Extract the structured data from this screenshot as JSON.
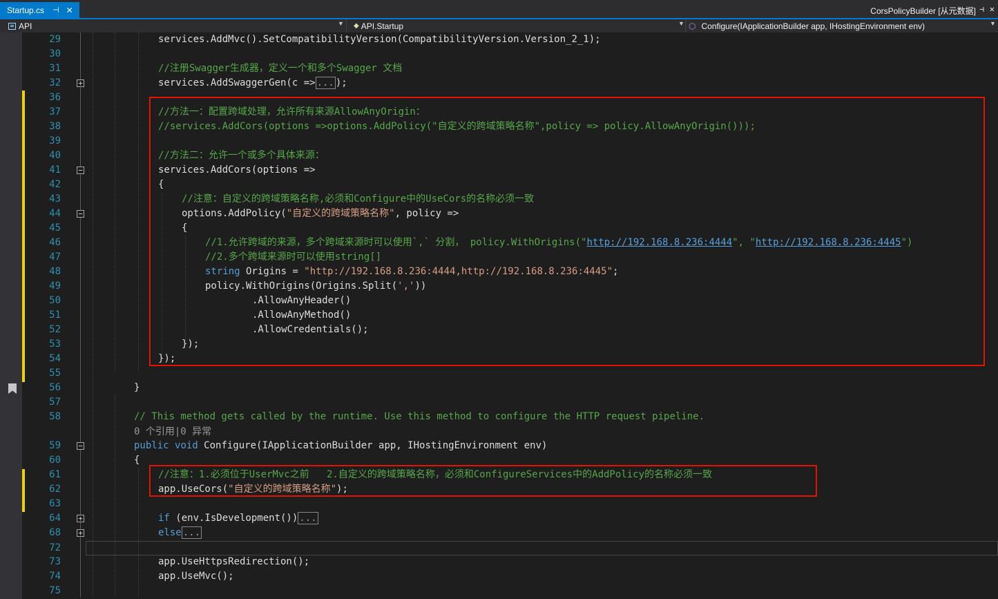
{
  "tabs": {
    "active_file": "Startup.cs",
    "pin_glyph": "⊣",
    "close_glyph": "✕",
    "right_title": "CorsPolicyBuilder [从元数据]",
    "right_pin_glyph": "⊣",
    "right_close_glyph": "✕"
  },
  "navbar": {
    "project": "API",
    "class_name": "API.Startup",
    "member": "Configure(IApplicationBuilder app, IHostingEnvironment env)"
  },
  "colors": {
    "accent": "#007acc",
    "highlight_box": "#e51400",
    "change_marker": "#f2d100",
    "keyword": "#569cd6",
    "string": "#d69d85",
    "comment": "#57a64a",
    "line_number": "#2b91af"
  },
  "editor": {
    "line_numbers": [
      "29",
      "30",
      "31",
      "32",
      "36",
      "37",
      "38",
      "39",
      "40",
      "41",
      "42",
      "43",
      "44",
      "45",
      "46",
      "47",
      "48",
      "49",
      "50",
      "51",
      "52",
      "53",
      "54",
      "55",
      "56",
      "57",
      "58",
      "59",
      "60",
      "61",
      "62",
      "63",
      "64",
      "68",
      "72",
      "73",
      "74",
      "75"
    ],
    "code_lens": "0 个引用|0 异常",
    "lines": [
      [
        {
          "t": "services.AddMvc().SetCompatibilityVersion(CompatibilityVersion.Version_2_1);"
        }
      ],
      [],
      [
        {
          "t": "//注册Swagger生成器，定义一个和多个Swagger 文档",
          "c": "cmt"
        }
      ],
      [
        {
          "t": "services.AddSwaggerGen(c =>"
        },
        {
          "t": "...",
          "c": "collapsed"
        },
        {
          "t": ");"
        }
      ],
      [],
      [
        {
          "t": "//方法一：配置跨域处理，允许所有来源AllowAnyOrigin：",
          "c": "cmt"
        }
      ],
      [
        {
          "t": "//services.AddCors(options =>options.AddPolicy(\"自定义的跨域策略名称\",policy => policy.AllowAnyOrigin()));",
          "c": "cmt"
        }
      ],
      [],
      [
        {
          "t": "//方法二：允许一个或多个具体来源：",
          "c": "cmt"
        }
      ],
      [
        {
          "t": "services.AddCors(options =>"
        }
      ],
      [
        {
          "t": "{"
        }
      ],
      [
        {
          "t": "//注意：自定义的跨域策略名称,必须和Configure中的UseCors的名称必须一致",
          "c": "cmt"
        }
      ],
      [
        {
          "t": "options.AddPolicy("
        },
        {
          "t": "\"自定义的跨域策略名称\"",
          "c": "str"
        },
        {
          "t": ", policy =>"
        }
      ],
      [
        {
          "t": "{"
        }
      ],
      [
        {
          "t": "//1.允许跨域的来源，多个跨域来源时可以使用`,` 分割， policy.WithOrigins(\"",
          "c": "cmt"
        },
        {
          "t": "http://192.168.8.236:4444",
          "c": "link"
        },
        {
          "t": "\", \"",
          "c": "cmt"
        },
        {
          "t": "http://192.168.8.236:4445",
          "c": "link"
        },
        {
          "t": "\")",
          "c": "cmt"
        }
      ],
      [
        {
          "t": "//2.多个跨域来源时可以使用string[]",
          "c": "cmt"
        }
      ],
      [
        {
          "t": "string",
          "c": "kw"
        },
        {
          "t": " Origins = "
        },
        {
          "t": "\"http://192.168.8.236:4444,http://192.168.8.236:4445\"",
          "c": "str"
        },
        {
          "t": ";"
        }
      ],
      [
        {
          "t": "policy.WithOrigins(Origins.Split("
        },
        {
          "t": "','",
          "c": "str"
        },
        {
          "t": "))"
        }
      ],
      [
        {
          "t": ".AllowAnyHeader()"
        }
      ],
      [
        {
          "t": ".AllowAnyMethod()"
        }
      ],
      [
        {
          "t": ".AllowCredentials();"
        }
      ],
      [
        {
          "t": "});"
        }
      ],
      [
        {
          "t": "});"
        }
      ],
      [],
      [
        {
          "t": "}"
        }
      ],
      [],
      [
        {
          "t": "// This method gets called by the runtime. Use this method to configure the HTTP request pipeline.",
          "c": "cmt"
        }
      ],
      [
        {
          "t": "public",
          "c": "kw"
        },
        {
          "t": " "
        },
        {
          "t": "void",
          "c": "kw"
        },
        {
          "t": " Configure(IApplicationBuilder app, IHostingEnvironment env)"
        }
      ],
      [
        {
          "t": "{"
        }
      ],
      [
        {
          "t": "//注意：1.必须位于UserMvc之前   2.自定义的跨域策略名称，必须和ConfigureServices中的AddPolicy的名称必须一致",
          "c": "cmt"
        }
      ],
      [
        {
          "t": "app.UseCors("
        },
        {
          "t": "\"自定义的跨域策略名称\"",
          "c": "str"
        },
        {
          "t": ");"
        }
      ],
      [],
      [
        {
          "t": "if",
          "c": "kw"
        },
        {
          "t": " (env.IsDevelopment())"
        },
        {
          "t": "...",
          "c": "collapsed"
        }
      ],
      [
        {
          "t": "else",
          "c": "kw"
        },
        {
          "t": "...",
          "c": "collapsed"
        }
      ],
      [],
      [
        {
          "t": "app.UseHttpsRedirection();"
        }
      ],
      [
        {
          "t": "app.UseMvc();"
        }
      ],
      []
    ]
  }
}
